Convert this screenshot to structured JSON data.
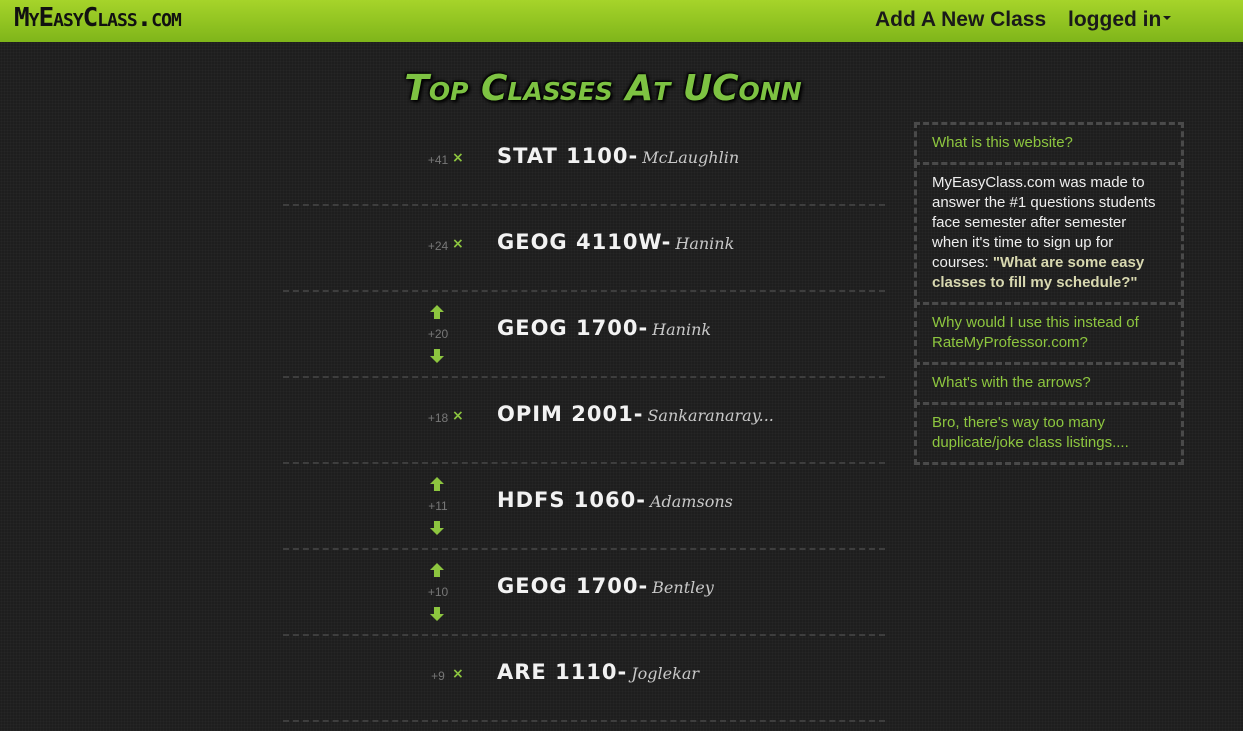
{
  "header": {
    "brand": "MyEasyClass.com",
    "add_class": "Add A New Class",
    "user_menu": "logged in"
  },
  "page_title": "Top Classes At UConn",
  "classes": [
    {
      "score": "+41",
      "code": "STAT 1100",
      "prof": "McLaughlin",
      "controls": "remove"
    },
    {
      "score": "+24",
      "code": "GEOG 4110W",
      "prof": "Hanink",
      "controls": "remove"
    },
    {
      "score": "+20",
      "code": "GEOG 1700",
      "prof": "Hanink",
      "controls": "arrows"
    },
    {
      "score": "+18",
      "code": "OPIM 2001",
      "prof": "Sankaranaray...",
      "controls": "remove"
    },
    {
      "score": "+11",
      "code": "HDFS 1060",
      "prof": "Adamsons",
      "controls": "arrows"
    },
    {
      "score": "+10",
      "code": "GEOG 1700",
      "prof": "Bentley",
      "controls": "arrows"
    },
    {
      "score": "+9",
      "code": "ARE 1110",
      "prof": "Joglekar",
      "controls": "remove"
    }
  ],
  "row_separator": "-",
  "remove_glyph": "×",
  "sidebar": {
    "q1": "What is this website?",
    "a1_text": "MyEasyClass.com was made to answer the #1 questions students face semester after semester when it's time to sign up for courses: ",
    "a1_bold": "\"What are some easy classes to fill my schedule?\"",
    "q2": "Why would I use this instead of RateMyProfessor.com?",
    "q3": "What's with the arrows?",
    "q4": "Bro, there's way too many duplicate/joke class listings...."
  },
  "colors": {
    "accent": "#8dc63f",
    "navbar": "#a6d42a",
    "background": "#1e1e1e"
  },
  "icons": {
    "upvote": "arrow-up-icon",
    "downvote": "arrow-down-icon",
    "remove": "close-icon",
    "menu": "caret-down-icon"
  }
}
